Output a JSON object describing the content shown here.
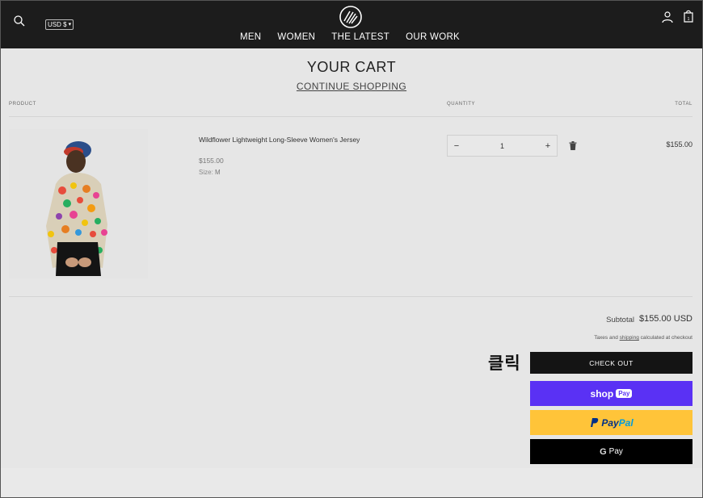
{
  "header": {
    "currency": "USD $",
    "nav": [
      "MEN",
      "WOMEN",
      "THE LATEST",
      "OUR WORK"
    ],
    "cart_count": "1"
  },
  "cart": {
    "title": "YOUR CART",
    "continue_label": "CONTINUE SHOPPING",
    "columns": {
      "product": "PRODUCT",
      "quantity": "QUANTITY",
      "total": "TOTAL"
    },
    "item": {
      "title": "Wildflower Lightweight Long-Sleeve Women's Jersey",
      "price": "$155.00",
      "size_label": "Size:",
      "size_value": "M",
      "quantity": "1",
      "line_total": "$155.00"
    },
    "qty_minus": "−",
    "qty_plus": "+"
  },
  "summary": {
    "subtotal_label": "Subtotal",
    "subtotal_value": "$155.00 USD",
    "tax_prefix": "Taxes and",
    "tax_link": "shipping",
    "tax_suffix": "calculated at checkout",
    "checkout_label": "CHECK OUT",
    "shop_pay_text": "shop",
    "shop_pay_pill": "Pay",
    "paypal_p1": "Pay",
    "paypal_p2": "Pal",
    "gpay_g": "G",
    "gpay_text": "Pay"
  },
  "annotation": "클릭",
  "colors": {
    "header_bg": "#1c1c1c",
    "shop_pay": "#5a31f4",
    "paypal": "#ffc439",
    "checkout": "#141414"
  }
}
